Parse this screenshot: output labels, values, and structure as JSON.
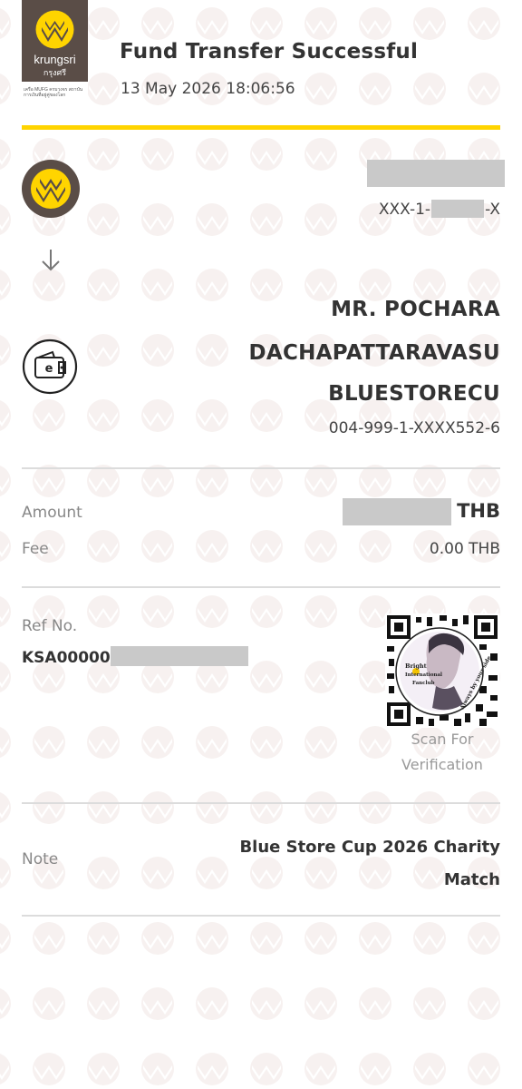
{
  "bank": {
    "name": "krungsri",
    "name_thai": "กรุงศรี",
    "tagline": "เครือ MUFG ครบวงจร สถาบันการเงินที่อยู่คู่ของโลก",
    "brand_color": "#5a4d47",
    "accent_color": "#ffd400"
  },
  "header": {
    "title": "Fund Transfer Successful",
    "datetime": "13 May 2026 18:06:56"
  },
  "sender": {
    "account_prefix": "XXX-1-",
    "account_suffix": "-X"
  },
  "recipient": {
    "name_line_1": "MR. POCHARA",
    "name_line_2": "DACHAPATTARAVASU",
    "name_line_3": "BLUESTORECU",
    "account": "004-999-1-XXXX552-6"
  },
  "amount": {
    "label": "Amount",
    "currency": "THB"
  },
  "fee": {
    "label": "Fee",
    "value": "0.00 THB"
  },
  "reference": {
    "label": "Ref No.",
    "value_prefix": "KSA00000"
  },
  "qr": {
    "sticker_text_1": "Bright",
    "sticker_text_2": "International",
    "sticker_text_3": "Fanclub",
    "sticker_text_4": "Always by your side",
    "caption_line_1": "Scan For",
    "caption_line_2": "Verification"
  },
  "note": {
    "label": "Note",
    "value": "Blue Store Cup 2026 Charity Match"
  },
  "icons": {
    "sender": "krungsri-logo-icon",
    "arrow": "arrow-down-icon",
    "recipient": "wallet-icon"
  }
}
